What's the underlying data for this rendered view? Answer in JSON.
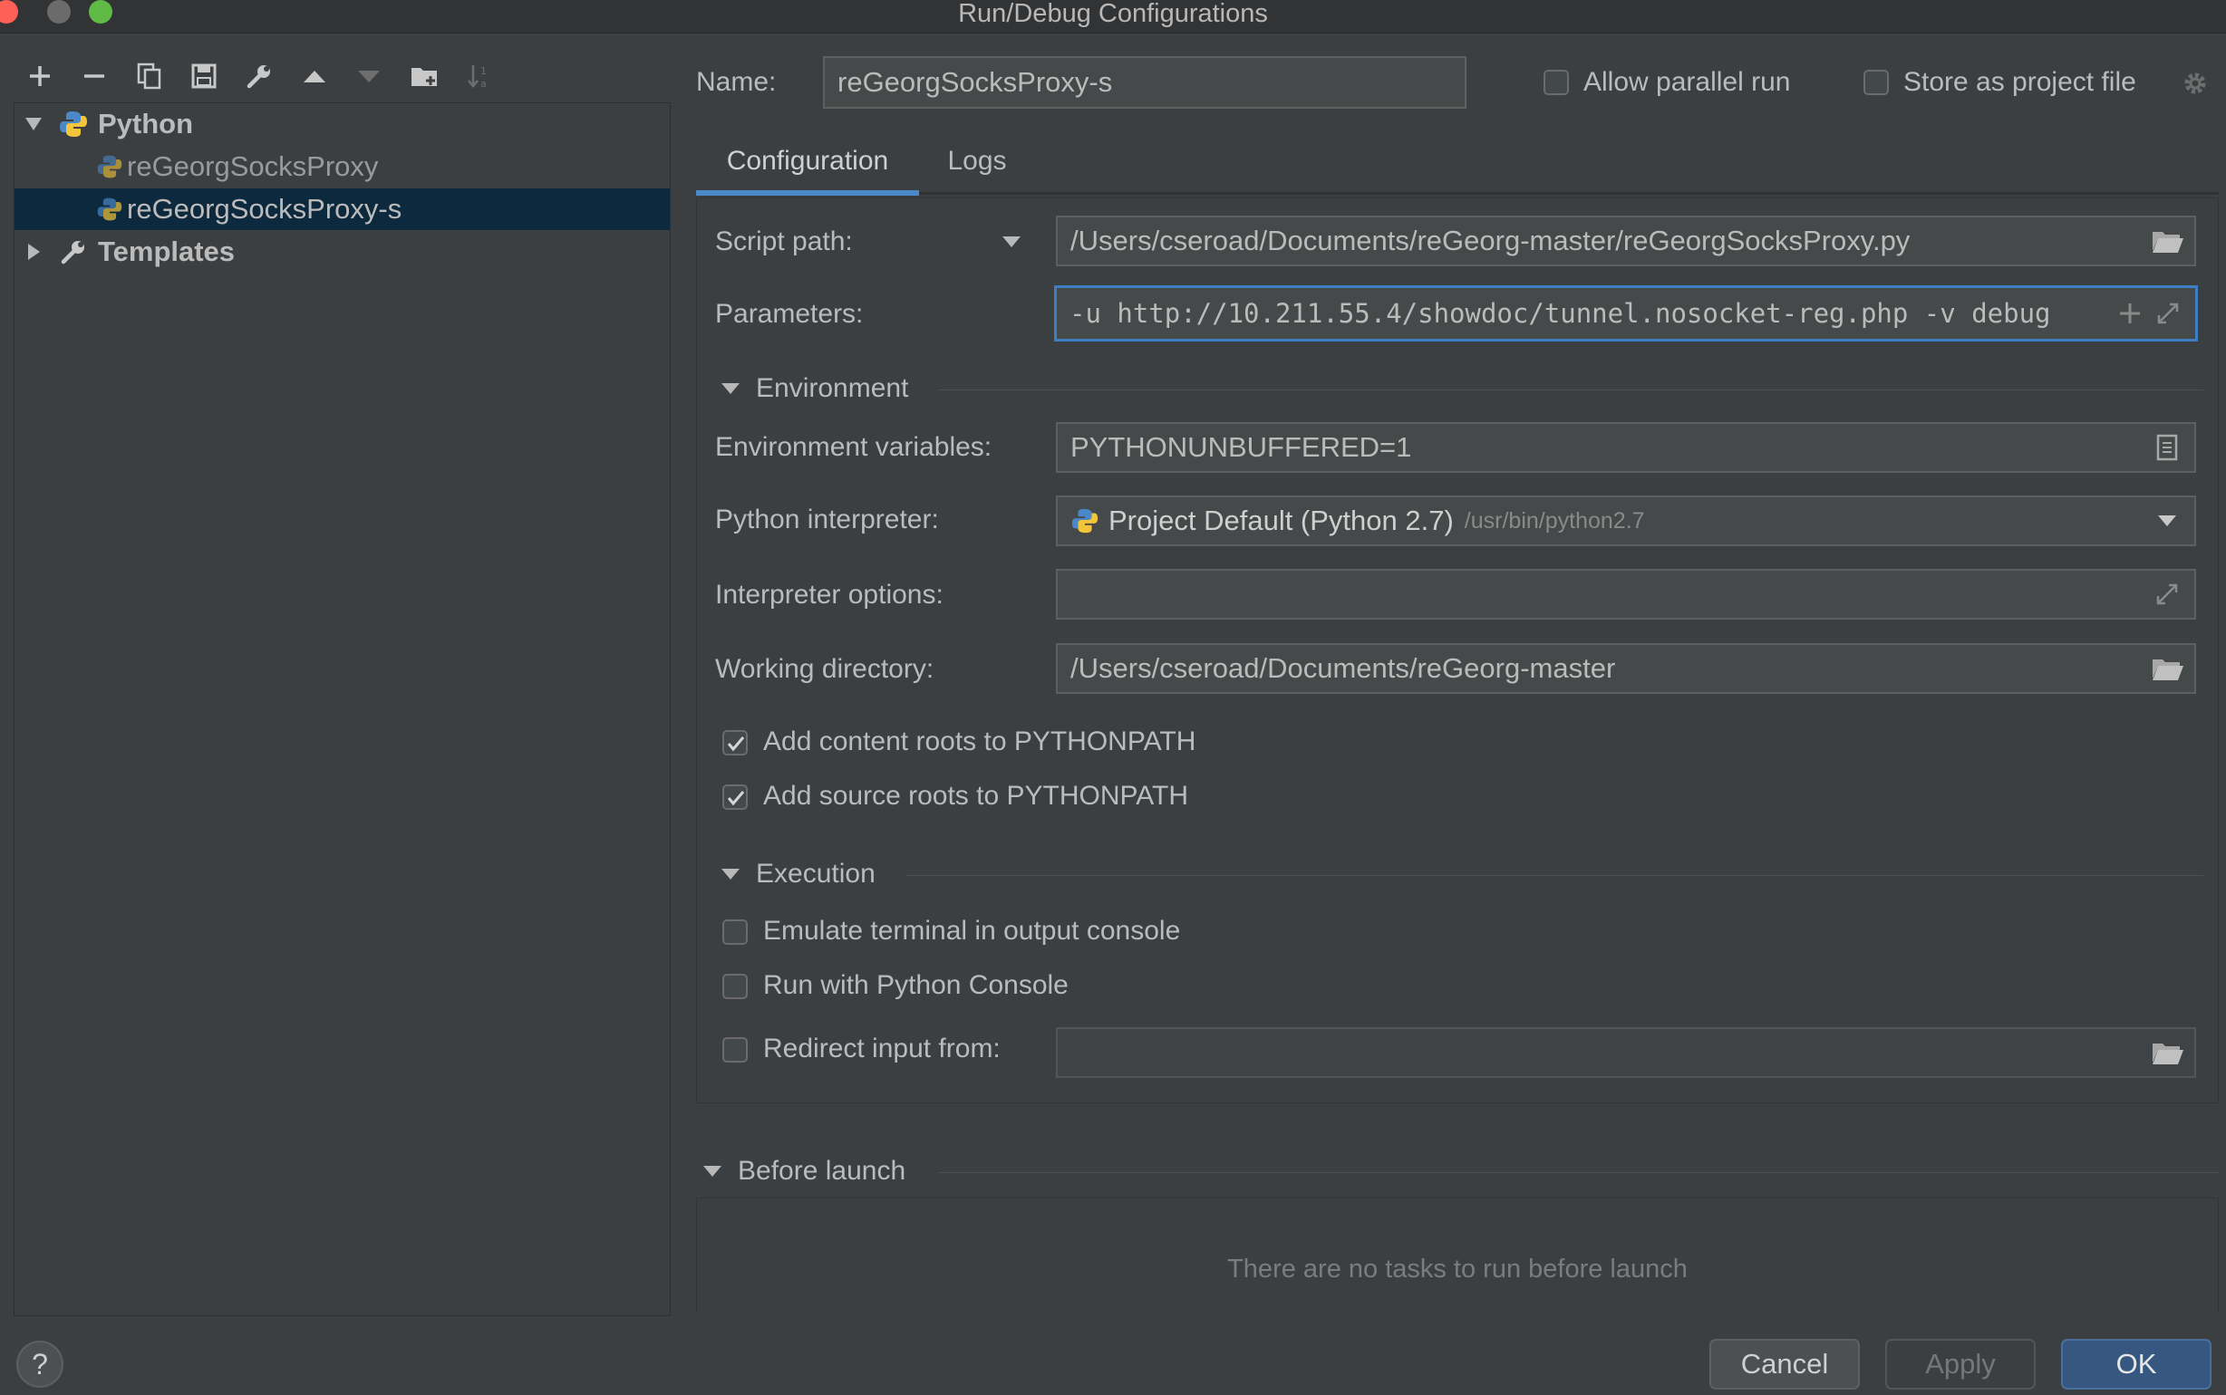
{
  "window": {
    "title": "Run/Debug Configurations"
  },
  "toolbar": {
    "icons": [
      "add-icon",
      "remove-icon",
      "copy-icon",
      "save-icon",
      "wrench-icon",
      "move-up-icon",
      "move-down-icon",
      "folder-icon",
      "sort-icon"
    ]
  },
  "tree": {
    "python_group": "Python",
    "items": [
      "reGeorgSocksProxy",
      "reGeorgSocksProxy-s"
    ],
    "templates": "Templates"
  },
  "header": {
    "name_label": "Name:",
    "name_value": "reGeorgSocksProxy-s",
    "allow_parallel": {
      "label": "Allow parallel run",
      "checked": false
    },
    "store_project": {
      "label": "Store as project file",
      "checked": false
    }
  },
  "tabs": [
    "Configuration",
    "Logs"
  ],
  "config": {
    "script_path_label": "Script path:",
    "script_path": "/Users/cseroad/Documents/reGeorg-master/reGeorgSocksProxy.py",
    "parameters_label": "Parameters:",
    "parameters": "-u http://10.211.55.4/showdoc/tunnel.nosocket-reg.php -v debug",
    "environment_section": "Environment",
    "env_vars_label": "Environment variables:",
    "env_vars": "PYTHONUNBUFFERED=1",
    "interpreter_label": "Python interpreter:",
    "interpreter_name": "Project Default (Python 2.7)",
    "interpreter_path": "/usr/bin/python2.7",
    "interp_options_label": "Interpreter options:",
    "interp_options": "",
    "working_dir_label": "Working directory:",
    "working_dir": "/Users/cseroad/Documents/reGeorg-master",
    "add_content_roots": {
      "label": "Add content roots to PYTHONPATH",
      "checked": true
    },
    "add_source_roots": {
      "label": "Add source roots to PYTHONPATH",
      "checked": true
    },
    "execution_section": "Execution",
    "emulate_terminal": {
      "label": "Emulate terminal in output console",
      "checked": false
    },
    "run_python_console": {
      "label": "Run with Python Console",
      "checked": false
    },
    "redirect_input": {
      "label": "Redirect input from:",
      "checked": false,
      "value": ""
    }
  },
  "before_launch": {
    "title": "Before launch",
    "empty_text": "There are no tasks to run before launch"
  },
  "footer": {
    "help": "?",
    "cancel": "Cancel",
    "apply": "Apply",
    "ok": "OK"
  },
  "colors": {
    "background": "#3c3f41",
    "selection": "#0d293e",
    "accent": "#4a88c7",
    "ok_button": "#365880"
  }
}
